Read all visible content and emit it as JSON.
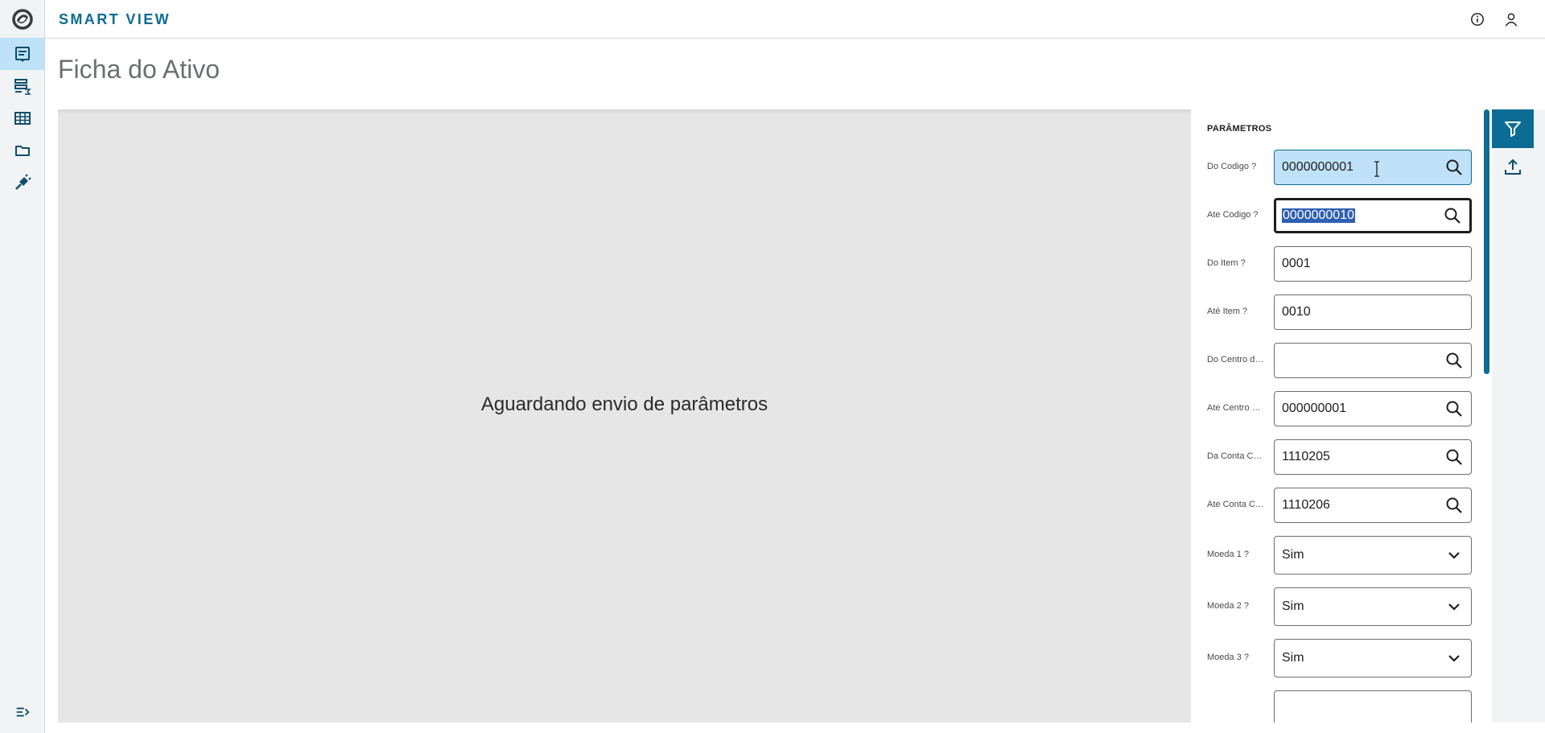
{
  "header": {
    "brand": "SMART VIEW",
    "info_icon": "info-icon",
    "user_icon": "user-icon"
  },
  "sidebar": {
    "logo_icon": "totvs-logo-icon",
    "items": [
      {
        "icon": "report-icon",
        "active": true
      },
      {
        "icon": "data-view-sum-icon",
        "active": false
      },
      {
        "icon": "table-icon",
        "active": false
      },
      {
        "icon": "folder-icon",
        "active": false
      },
      {
        "icon": "plug-icon",
        "active": false
      }
    ],
    "collapse_icon": "expand-menu-icon"
  },
  "page": {
    "title": "Ficha do Ativo",
    "waiting_message": "Aguardando envio de parâmetros"
  },
  "params": {
    "title": "PARÂMETROS",
    "fields": [
      {
        "label": "Do Codigo ?",
        "value": "0000000001",
        "type": "lookup",
        "state": "hover"
      },
      {
        "label": "Ate Codigo ?",
        "value": "0000000010",
        "type": "lookup",
        "state": "focus"
      },
      {
        "label": "Do Item ?",
        "value": "0001",
        "type": "text",
        "state": "normal"
      },
      {
        "label": "Até Item ?",
        "value": "0010",
        "type": "text",
        "state": "normal"
      },
      {
        "label": "Do Centro de...",
        "value": "",
        "type": "lookup",
        "state": "normal"
      },
      {
        "label": "Ate Centro C...",
        "value": "000000001",
        "type": "lookup",
        "state": "normal"
      },
      {
        "label": "Da Conta Co...",
        "value": "1110205",
        "type": "lookup",
        "state": "normal"
      },
      {
        "label": "Ate Conta Co...",
        "value": "1110206",
        "type": "lookup",
        "state": "normal"
      },
      {
        "label": "Moeda 1 ?",
        "value": "Sim",
        "type": "select",
        "state": "normal"
      },
      {
        "label": "Moeda 2 ?",
        "value": "Sim",
        "type": "select",
        "state": "normal"
      },
      {
        "label": "Moeda 3 ?",
        "value": "Sim",
        "type": "select",
        "state": "normal"
      }
    ]
  },
  "toolbar": {
    "filter_icon": "filter-icon",
    "export_icon": "upload-icon"
  },
  "colors": {
    "primary": "#0c6c94",
    "hover": "#bfe2f8",
    "selection": "#2e5fb3",
    "content_bg": "#e6e6e6"
  }
}
